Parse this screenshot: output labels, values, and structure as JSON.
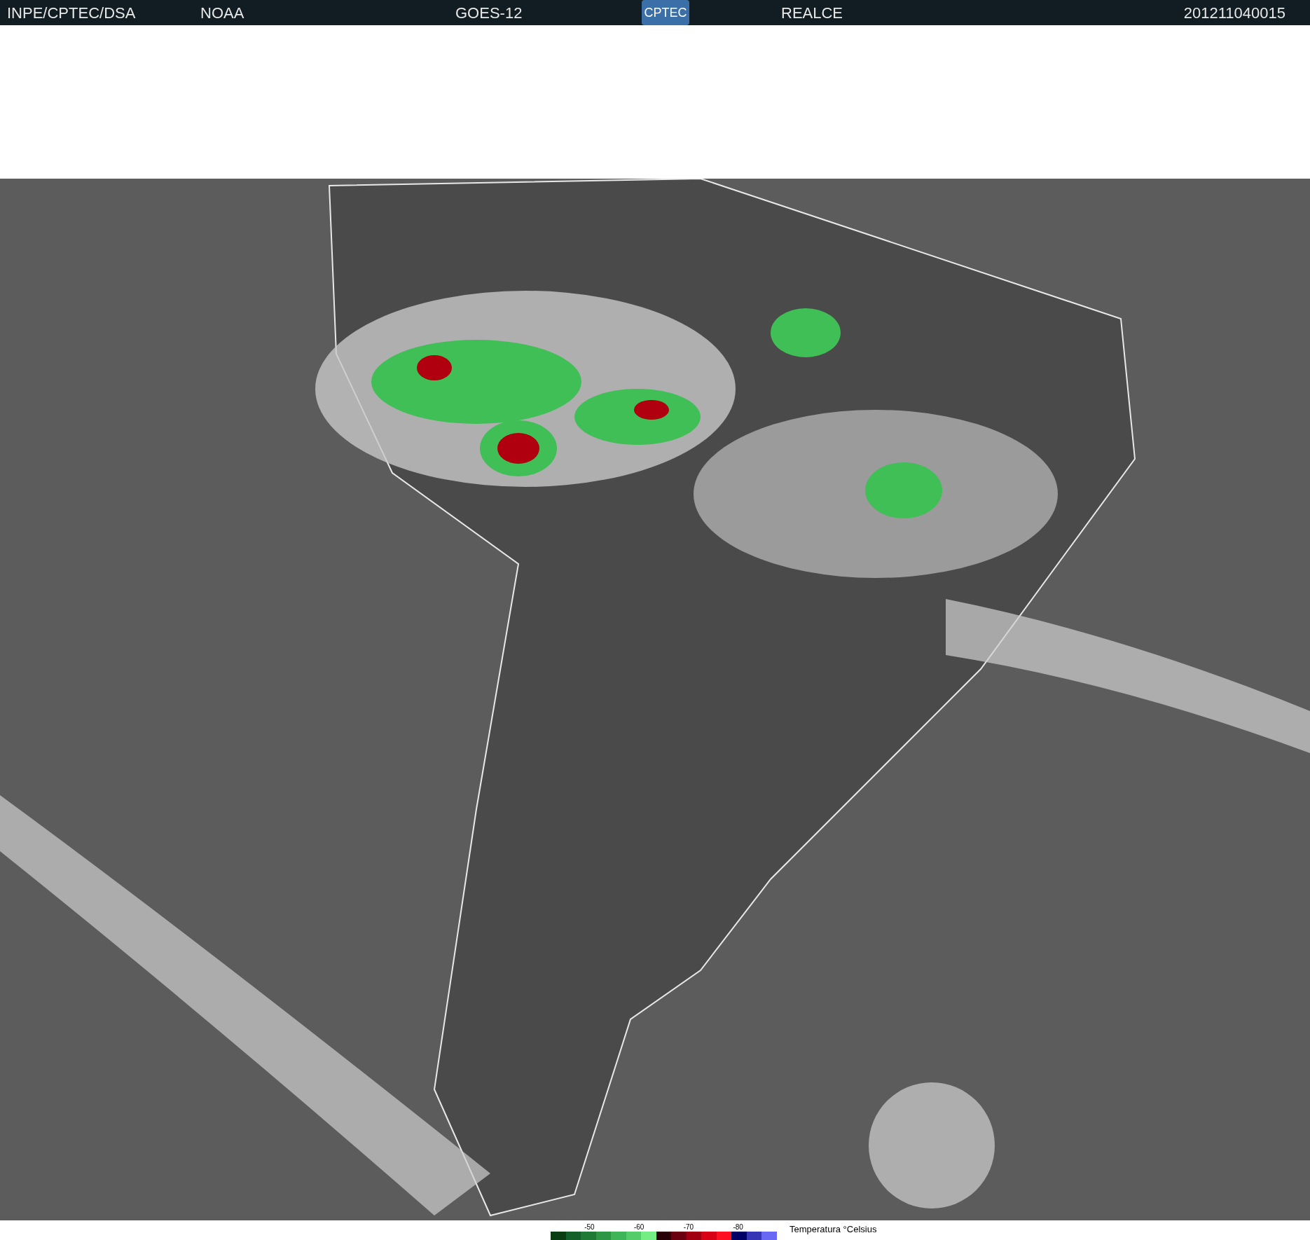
{
  "header": {
    "items": [
      "INPE/CPTEC/DSA",
      "NOAA",
      "GOES-12"
    ],
    "logo": "CPTEC",
    "product": "REALCE",
    "timestamp": "201211040015"
  },
  "legend": {
    "ticks": [
      "-50",
      "-60",
      "-70",
      "-80"
    ],
    "title": "Temperatura °Celsius",
    "swatches": [
      {
        "color": "#0b3d12"
      },
      {
        "color": "#15602a"
      },
      {
        "color": "#1f7a35"
      },
      {
        "color": "#2e9645"
      },
      {
        "color": "#40b458"
      },
      {
        "color": "#55cc6a"
      },
      {
        "color": "#74ee84"
      },
      {
        "color": "#2a0008"
      },
      {
        "color": "#6a0010"
      },
      {
        "color": "#a00012"
      },
      {
        "color": "#d80014"
      },
      {
        "color": "#ff1020"
      },
      {
        "color": "#000066"
      },
      {
        "color": "#3535b5"
      },
      {
        "color": "#6868f5"
      }
    ]
  }
}
